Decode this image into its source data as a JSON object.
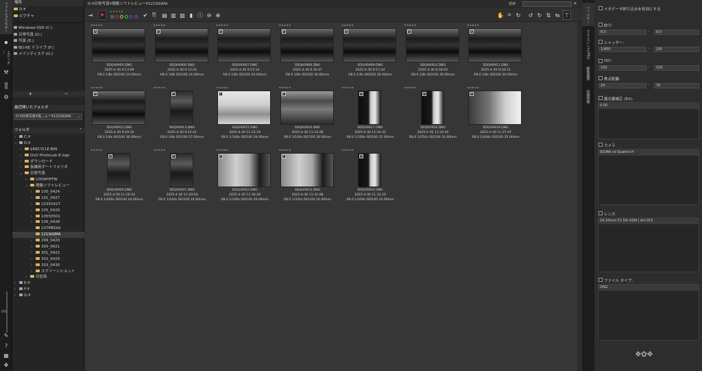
{
  "rail": {
    "tabs": [
      "ファイルブラウザー",
      "エディター",
      "環境"
    ],
    "zoom_percent": "0%"
  },
  "sidebar": {
    "places_header": "場所",
    "places": [
      "D:¥",
      "ピクチャ"
    ],
    "drives": [
      "Windows-SSD (C:)",
      "日常写真 (D:)",
      "写真 (E:)",
      "BD-RE ドライブ (F:)",
      "メインディスク (G:)"
    ],
    "add_label": "+",
    "remove_label": "−",
    "recent_header": "最近開いたフォルダ",
    "recent_value": "D:¥日常写真¥現...ュー¥121SIGMA",
    "folders_header": "フォルダ",
    "tree": [
      {
        "label": "C:¥",
        "indent": 0,
        "tri": "›",
        "kind": "drive"
      },
      {
        "label": "D:¥",
        "indent": 0,
        "tri": "⌄",
        "kind": "drive"
      },
      {
        "label": "$RECYCLE.BIN",
        "indent": 1,
        "tri": "›",
        "kind": "folder"
      },
      {
        "label": "DxO PhotoLab 8 logs",
        "indent": 1,
        "tri": "›",
        "kind": "folder"
      },
      {
        "label": "ダウンロード",
        "indent": 1,
        "tri": "›",
        "kind": "folder"
      },
      {
        "label": "仮撮用ポートフォリオ",
        "indent": 1,
        "tri": "›",
        "kind": "folder"
      },
      {
        "label": "日常写真",
        "indent": 1,
        "tri": "⌄",
        "kind": "folder"
      },
      {
        "label": "100WHFFW",
        "indent": 2,
        "tri": "›",
        "kind": "folder"
      },
      {
        "label": "現像ソフトレビュー",
        "indent": 2,
        "tri": "⌄",
        "kind": "folder"
      },
      {
        "label": "100_0424",
        "indent": 3,
        "tri": "›",
        "kind": "folder"
      },
      {
        "label": "101_0427",
        "indent": 3,
        "tri": "›",
        "kind": "folder"
      },
      {
        "label": "10350427",
        "indent": 3,
        "tri": "›",
        "kind": "folder"
      },
      {
        "label": "105_0420",
        "indent": 3,
        "tri": "›",
        "kind": "folder"
      },
      {
        "label": "10550501",
        "indent": 3,
        "tri": "›",
        "kind": "folder"
      },
      {
        "label": "106_0428",
        "indent": 3,
        "tri": "›",
        "kind": "folder"
      },
      {
        "label": "107MEDIA",
        "indent": 3,
        "tri": "",
        "kind": "folder"
      },
      {
        "label": "121SIGMA",
        "indent": 3,
        "tri": "",
        "kind": "folder",
        "selected": true
      },
      {
        "label": "299_0420",
        "indent": 3,
        "tri": "›",
        "kind": "folder"
      },
      {
        "label": "300_0421",
        "indent": 3,
        "tri": "›",
        "kind": "folder"
      },
      {
        "label": "301_0422",
        "indent": 3,
        "tri": "›",
        "kind": "folder"
      },
      {
        "label": "302_0424",
        "indent": 3,
        "tri": "›",
        "kind": "folder"
      },
      {
        "label": "303_0430",
        "indent": 3,
        "tri": "›",
        "kind": "folder"
      },
      {
        "label": "スクリーンショット",
        "indent": 3,
        "tri": "›",
        "kind": "folder"
      },
      {
        "label": "日記用",
        "indent": 2,
        "tri": "›",
        "kind": "folder"
      },
      {
        "label": "E:¥",
        "indent": 0,
        "tri": "›",
        "kind": "drive"
      },
      {
        "label": "F:¥",
        "indent": 0,
        "tri": "›",
        "kind": "drive"
      },
      {
        "label": "G:¥",
        "indent": 0,
        "tri": "›",
        "kind": "drive"
      }
    ]
  },
  "main": {
    "title": "D:¥日常写真¥現像ソフトレビュー¥121SIGMA",
    "search_label": "検索:",
    "stars": "★★★★★",
    "thumbs": [
      {
        "name": "SDQH0905.DNG",
        "date": "2025-4-30 9:13:09",
        "exif": "f/8.0 1/8s ISO100 24.00mm",
        "tone": "forest"
      },
      {
        "name": "SDQH0906.DNG",
        "date": "2025-4-30 9:13:16",
        "exif": "f/8.0 1/8s ISO100 24.00mm",
        "tone": "forest"
      },
      {
        "name": "SDQH0907.DNG",
        "date": "2025-4-30 9:15:14",
        "exif": "f/8.0 1/8s ISO100 24.00mm",
        "tone": "forest"
      },
      {
        "name": "SDQH0908.DNG",
        "date": "2025-4-30 9:16:47",
        "exif": "f/8.0 1/8s ISO100 30.00mm",
        "tone": "forest"
      },
      {
        "name": "SDQH0909.DNG",
        "date": "2025-4-30 9:17:24",
        "exif": "f/8.0 1/8s ISO100 30.00mm",
        "tone": "forest"
      },
      {
        "name": "SDQH0910.DNG",
        "date": "2025-4-30 9:18:03",
        "exif": "f/8.0 1/8s ISO100 30.00mm",
        "tone": "forest"
      },
      {
        "name": "SDQH0911.DNG",
        "date": "2025-4-30 9:18:13",
        "exif": "f/8.0 1/8s ISO100 30.00mm",
        "tone": "forest"
      },
      {
        "name": "SDQH0912.DNG",
        "date": "2025-4-30 9:19:10",
        "exif": "f/8.0 1/8s ISO100 30.00mm",
        "tone": "forest"
      },
      {
        "name": "SDQH0913.DNG",
        "date": "2025-4-30 9:22:41",
        "exif": "f/8.0 1/8s ISO100 27.00mm",
        "tone": "dark",
        "portrait": true
      },
      {
        "name": "SDQH0915.DNG",
        "date": "2025-4-30 11:23:19",
        "exif": "f/8.0 1/160s ISO100 28.00mm",
        "tone": "bright"
      },
      {
        "name": "SDQH0916.DNG",
        "date": "2025-4-30 11:23:28",
        "exif": "f/8.0 1/100s ISO100 28.00mm",
        "tone": "gravel"
      },
      {
        "name": "SDQH0917.DNG",
        "date": "2025-4-30 11:24:32",
        "exif": "f/8.0 1/100s ISO100 31.00mm",
        "tone": "door",
        "portrait": true
      },
      {
        "name": "SDQH0918.DNG",
        "date": "2025-4-30 11:24:45",
        "exif": "f/8.0 1/250s ISO100 31.00mm",
        "tone": "door",
        "portrait": true
      },
      {
        "name": "SDQH0919.DNG",
        "date": "2025-4-30 11:27:47",
        "exif": "f/8.0 1/400s ISO100 35.00mm",
        "tone": "street"
      },
      {
        "name": "SDQH0920.DNG",
        "date": "2025-4-30 11:29:24",
        "exif": "f/8.0 1/400s ISO100 24.00mm",
        "tone": "dark",
        "portrait": true
      },
      {
        "name": "SDQH0921.DNG",
        "date": "2025-4-30 11:29:54",
        "exif": "f/8.0 1/160s ISO100 24.00mm",
        "tone": "dark",
        "portrait": true
      },
      {
        "name": "SDQH0922.DNG",
        "date": "2025-4-30 11:30:29",
        "exif": "f/8.0 1/160s ISO100 29.00mm",
        "tone": "face"
      },
      {
        "name": "SDQH0923.DNG",
        "date": "2025-4-30 11:31:08",
        "exif": "f/8.0 1/320s ISO100 24.00mm",
        "tone": "face"
      },
      {
        "name": "SDQH0924.DNG",
        "date": "2025-4-30 11:32:10",
        "exif": "f/8.0 1/320s ISO100 24.00mm",
        "tone": "door",
        "portrait": true
      }
    ]
  },
  "right_tabs": [
    "フィルター",
    "カメラ/レンズ/PRO",
    "編集履歴",
    "詳細情報"
  ],
  "filter": {
    "enable_label": "メタデータ絞り込みを有効にする",
    "fnum_label": "絞り:",
    "fnum_from": "8.0",
    "fnum_to": "8.0",
    "shutter_label": "シャッター:",
    "shutter_from": "1/400",
    "shutter_to": "1/8",
    "iso_label": "ISO:",
    "iso_from": "100",
    "iso_to": "100",
    "focal_label": "焦点距離:",
    "focal_from": "24",
    "focal_to": "35",
    "range_sep": "-",
    "ev_label": "露光量補正 (EV):",
    "ev_value": "0.00",
    "camera_label": "カメラ",
    "camera_value": "SIGMA sd Quattro H",
    "lens_label": "レンズ:",
    "lens_value": "24-35mm F2 DG HSM | Art 015",
    "filetype_label": "ファイル タイプ:",
    "filetype_value": "DNG"
  }
}
